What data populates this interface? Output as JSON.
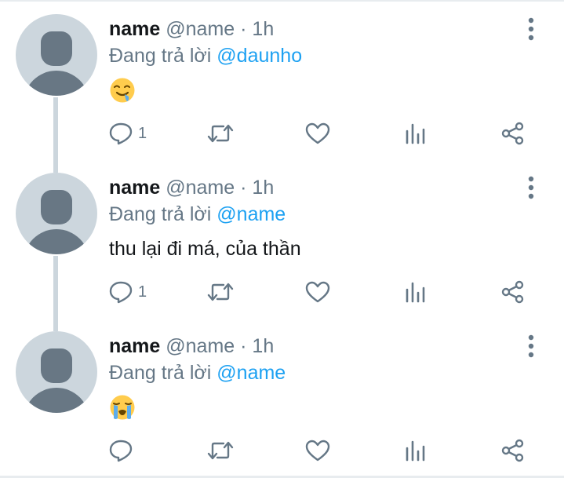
{
  "tweets": [
    {
      "display_name": "name",
      "handle": "@name",
      "separator": "·",
      "time": "1h",
      "reply_prefix": "Đang trả lời",
      "reply_to": "@daunho",
      "text": "",
      "emoji": "drooling-face",
      "reply_count": "1"
    },
    {
      "display_name": "name",
      "handle": "@name",
      "separator": "·",
      "time": "1h",
      "reply_prefix": "Đang trả lời",
      "reply_to": "@name",
      "text": "thu lại đi má, của thần",
      "emoji": "",
      "reply_count": "1"
    },
    {
      "display_name": "name",
      "handle": "@name",
      "separator": "·",
      "time": "1h",
      "reply_prefix": "Đang trả lời",
      "reply_to": "@name",
      "text": "",
      "emoji": "loudly-crying-face",
      "reply_count": ""
    }
  ],
  "icons": {
    "reply": "reply-icon",
    "retweet": "retweet-icon",
    "like": "heart-icon",
    "stats": "bar-chart-icon",
    "share": "share-icon",
    "menu": "more-vertical-icon"
  },
  "colors": {
    "text_primary": "#14171a",
    "text_secondary": "#657786",
    "mention": "#1da1f2",
    "avatar_bg": "#ccd6dd",
    "avatar_fg": "#687784"
  }
}
